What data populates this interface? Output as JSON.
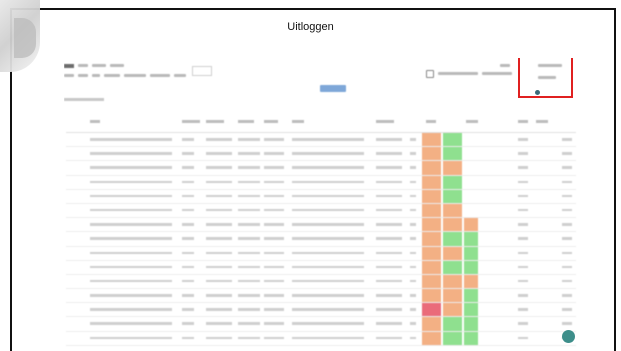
{
  "caption": {
    "text": "Uitloggen"
  },
  "screenshot": {
    "table": {
      "rows": [
        {
          "bar1": "orange",
          "bar2": "green",
          "bar3": ""
        },
        {
          "bar1": "orange",
          "bar2": "green",
          "bar3": ""
        },
        {
          "bar1": "orange",
          "bar2": "orange",
          "bar3": ""
        },
        {
          "bar1": "orange",
          "bar2": "green",
          "bar3": ""
        },
        {
          "bar1": "orange",
          "bar2": "green",
          "bar3": ""
        },
        {
          "bar1": "orange",
          "bar2": "orange",
          "bar3": ""
        },
        {
          "bar1": "orange",
          "bar2": "orange",
          "bar3": "orange"
        },
        {
          "bar1": "orange",
          "bar2": "green",
          "bar3": "green"
        },
        {
          "bar1": "orange",
          "bar2": "orange",
          "bar3": "green"
        },
        {
          "bar1": "orange",
          "bar2": "green",
          "bar3": "green"
        },
        {
          "bar1": "orange",
          "bar2": "orange",
          "bar3": "orange"
        },
        {
          "bar1": "orange",
          "bar2": "orange",
          "bar3": "green"
        },
        {
          "bar1": "pink",
          "bar2": "orange",
          "bar3": "green"
        },
        {
          "bar1": "orange",
          "bar2": "green",
          "bar3": "green"
        },
        {
          "bar1": "orange",
          "bar2": "green",
          "bar3": "green"
        }
      ]
    }
  },
  "colors": {
    "highlight_box": "#e02020",
    "status_orange": "#f3b084",
    "status_green": "#8fe08f",
    "status_pink": "#ea6b7a",
    "primary_button": "#7ea7d8",
    "fab": "#3d8e8a"
  },
  "icons": {
    "fab": "chat-icon",
    "refresh": "refresh-icon",
    "corner": "decorative-corner-icon"
  }
}
